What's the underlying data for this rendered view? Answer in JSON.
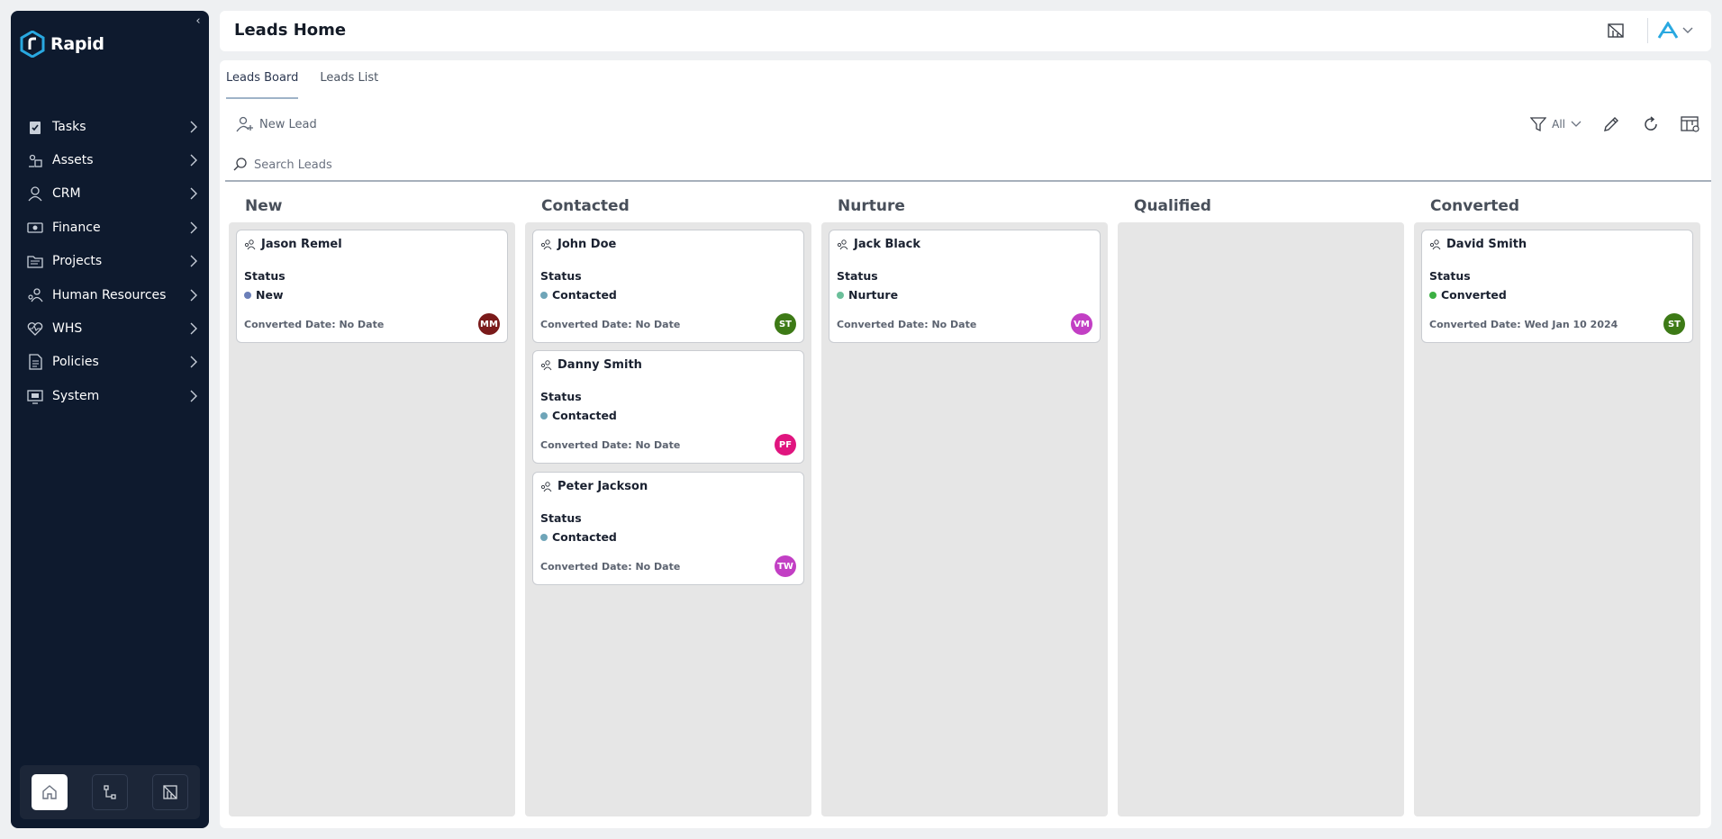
{
  "app": {
    "name": "Rapid"
  },
  "sidebar": {
    "items": [
      {
        "label": "Tasks",
        "icon": "clipboard-icon"
      },
      {
        "label": "Assets",
        "icon": "assets-icon"
      },
      {
        "label": "CRM",
        "icon": "user-icon"
      },
      {
        "label": "Finance",
        "icon": "money-icon"
      },
      {
        "label": "Projects",
        "icon": "folder-icon"
      },
      {
        "label": "Human Resources",
        "icon": "people-icon"
      },
      {
        "label": "WHS",
        "icon": "heart-pulse-icon"
      },
      {
        "label": "Policies",
        "icon": "document-icon"
      },
      {
        "label": "System",
        "icon": "system-icon"
      }
    ],
    "footer": [
      "home-icon",
      "workflow-icon",
      "board-icon"
    ]
  },
  "header": {
    "title": "Leads Home"
  },
  "tabs": [
    {
      "label": "Leads Board",
      "active": true
    },
    {
      "label": "Leads List",
      "active": false
    }
  ],
  "toolbar": {
    "new_lead_label": "New Lead",
    "filter_label": "All",
    "search_placeholder": "Search Leads"
  },
  "colors": {
    "status_new": "#6b7fb8",
    "status_contacted": "#6fa5b8",
    "status_nurture": "#6bbf9a",
    "status_converted": "#3cb043",
    "accent": "#29a8e0"
  },
  "board": {
    "columns": [
      {
        "title": "New",
        "cards": [
          {
            "name": "Jason Remel",
            "status_label": "Status",
            "status": "New",
            "dot": "#6b7fb8",
            "date_label": "Converted Date: No Date",
            "initials": "MM",
            "avatar_color": "#7a1a1a"
          }
        ]
      },
      {
        "title": "Contacted",
        "cards": [
          {
            "name": "John Doe",
            "status_label": "Status",
            "status": "Contacted",
            "dot": "#6fa5b8",
            "date_label": "Converted Date: No Date",
            "initials": "ST",
            "avatar_color": "#3d7a16"
          },
          {
            "name": "Danny Smith",
            "status_label": "Status",
            "status": "Contacted",
            "dot": "#6fa5b8",
            "date_label": "Converted Date: No Date",
            "initials": "PF",
            "avatar_color": "#e0157f"
          },
          {
            "name": "Peter Jackson",
            "status_label": "Status",
            "status": "Contacted",
            "dot": "#6fa5b8",
            "date_label": "Converted Date: No Date",
            "initials": "TW",
            "avatar_color": "#c23fc4"
          }
        ]
      },
      {
        "title": "Nurture",
        "cards": [
          {
            "name": "Jack Black",
            "status_label": "Status",
            "status": "Nurture",
            "dot": "#6bbf9a",
            "date_label": "Converted Date: No Date",
            "initials": "VM",
            "avatar_color": "#c23fc4"
          }
        ]
      },
      {
        "title": "Qualified",
        "cards": []
      },
      {
        "title": "Converted",
        "cards": [
          {
            "name": "David Smith",
            "status_label": "Status",
            "status": "Converted",
            "dot": "#3cb043",
            "date_label": "Converted Date: Wed Jan 10 2024",
            "initials": "ST",
            "avatar_color": "#3d7a16"
          }
        ]
      }
    ]
  }
}
